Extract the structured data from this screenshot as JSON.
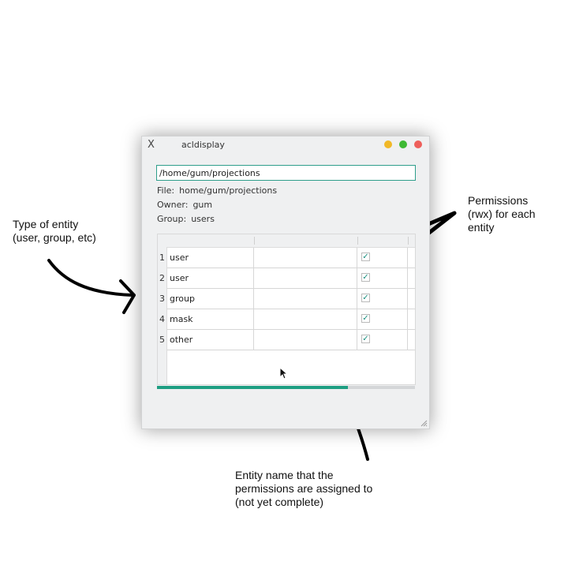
{
  "annotations": {
    "entity_type": "Type of entity\n(user, group, etc)",
    "permissions": "Permissions\n(rwx) for each\nentity",
    "entity_name": "Entity name that the\npermissions are assigned to\n(not yet complete)"
  },
  "window": {
    "title": "acldisplay",
    "close_glyph": "X"
  },
  "path_input": {
    "value": "/home/gum/projections"
  },
  "info": {
    "file_label": "File:",
    "file_value": "home/gum/projections",
    "owner_label": "Owner:",
    "owner_value": "gum",
    "group_label": "Group:",
    "group_value": "users"
  },
  "table": {
    "rows": [
      {
        "num": "1",
        "type": "user",
        "name": "",
        "checked": true
      },
      {
        "num": "2",
        "type": "user",
        "name": "",
        "checked": true
      },
      {
        "num": "3",
        "type": "group",
        "name": "",
        "checked": true
      },
      {
        "num": "4",
        "type": "mask",
        "name": "",
        "checked": true
      },
      {
        "num": "5",
        "type": "other",
        "name": "",
        "checked": true
      }
    ],
    "check_glyph": "✓"
  },
  "progress": {
    "fraction": 0.74
  },
  "colors": {
    "accent": "#1e9e82",
    "traffic_min": "#f1b827",
    "traffic_max": "#3eb934",
    "traffic_close": "#ee5f5b"
  }
}
